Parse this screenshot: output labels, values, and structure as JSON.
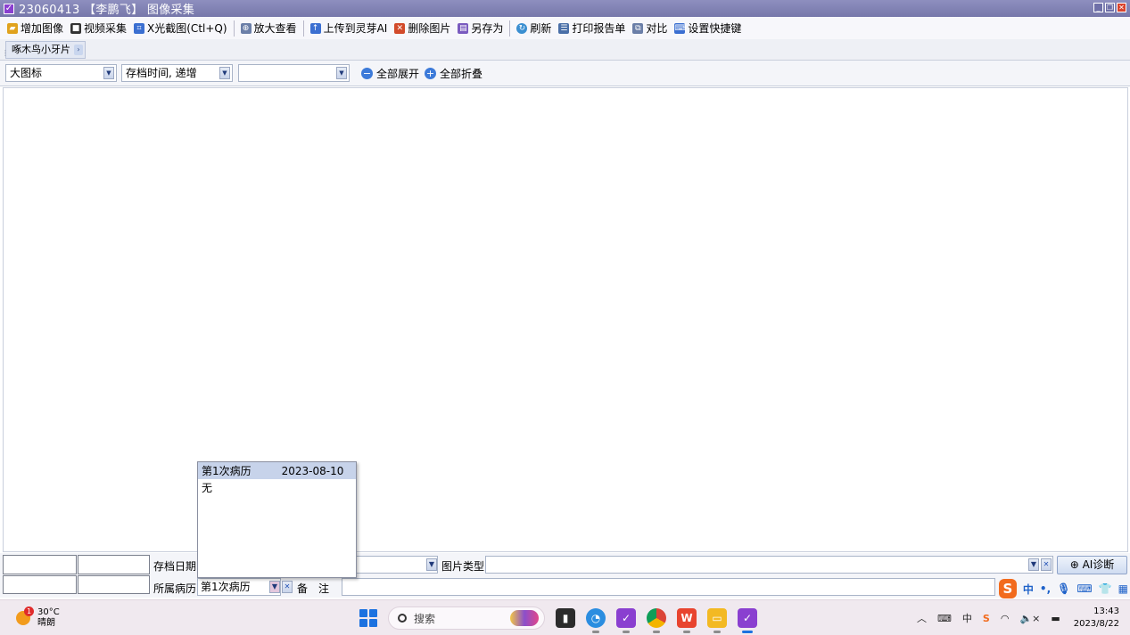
{
  "window": {
    "title": "23060413 【李鹏飞】 图像采集",
    "buttons": [
      "minimize",
      "restore",
      "close"
    ]
  },
  "toolbar": {
    "items": [
      {
        "label": "增加图像",
        "icon": "folder-add-icon",
        "color": "#e0a21d"
      },
      {
        "label": "视频采集",
        "icon": "video-icon",
        "color": "#333333"
      },
      {
        "label": "X光截图(Ctl+Q)",
        "icon": "xray-capture-icon",
        "color": "#3b6fd1"
      },
      {
        "label": "放大查看",
        "icon": "magnify-icon",
        "color": "#6b7fa8"
      },
      {
        "label": "上传到灵芽AI",
        "icon": "upload-icon",
        "color": "#3b6fd1"
      },
      {
        "label": "删除图片",
        "icon": "delete-image-icon",
        "color": "#d24a2a"
      },
      {
        "label": "另存为",
        "icon": "save-as-icon",
        "color": "#7a5bbf"
      },
      {
        "label": "刷新",
        "icon": "refresh-icon",
        "color": "#3b8fd1"
      },
      {
        "label": "打印报告单",
        "icon": "print-report-icon",
        "color": "#4a6fa8"
      },
      {
        "label": "对比",
        "icon": "compare-icon",
        "color": "#6b7fa8"
      },
      {
        "label": "设置快捷键",
        "icon": "shortcut-key-icon",
        "color": "#3b6fd1"
      }
    ]
  },
  "tabs": {
    "active": "啄木鸟小牙片"
  },
  "filters": {
    "view_mode": "大图标",
    "sort": "存档时间, 递增",
    "third": "",
    "expand_all": "全部展开",
    "collapse_all": "全部折叠"
  },
  "info": {
    "archive_date_label": "存档日期",
    "image_type_label": "图片类型",
    "image_type_value": "",
    "record_label": "所属病历",
    "record_value": "第1次病历",
    "note_label": "备　注",
    "note_value": "",
    "ai_button": "AI诊断"
  },
  "popup": {
    "selected_name": "第1次病历",
    "selected_date": "2023-08-10",
    "option_none": "无"
  },
  "ime": {
    "lang": "中",
    "punct": "•,"
  },
  "taskbar": {
    "weather_temp": "30°C",
    "weather_desc": "晴朗",
    "weather_badge": "1",
    "search_placeholder": "搜索",
    "time": "13:43",
    "date": "2023/8/22",
    "tray_lang": "中"
  }
}
